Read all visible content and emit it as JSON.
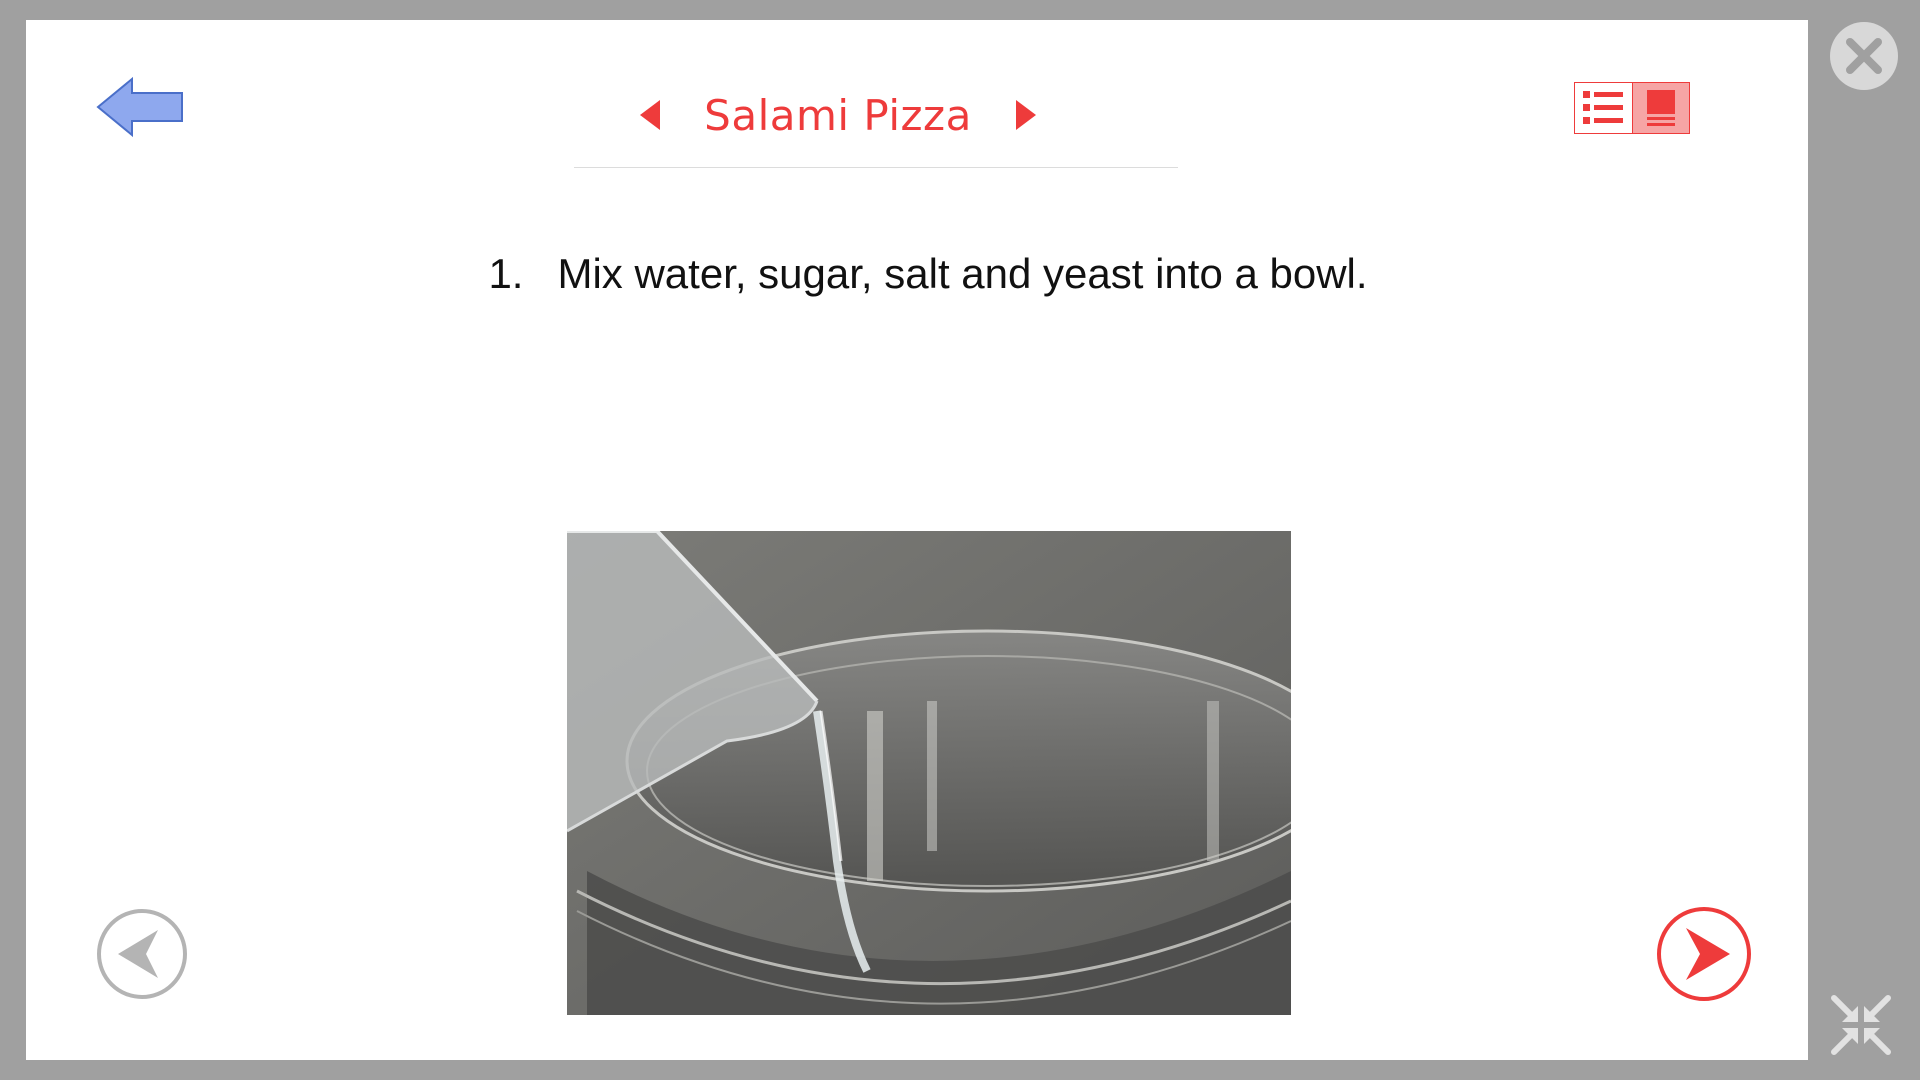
{
  "header": {
    "back_icon": "back-arrow-icon",
    "title": "Salami Pizza",
    "prev_recipe_icon": "triangle-left-icon",
    "next_recipe_icon": "triangle-right-icon"
  },
  "view_toggle": {
    "list_icon": "list-view-icon",
    "single_icon": "single-view-icon",
    "active": "single"
  },
  "step": {
    "number": "1.",
    "text": "Mix water, sugar, salt and yeast into a bowl."
  },
  "photo": {
    "icon": "water-pouring-into-bowl-photo"
  },
  "controls": {
    "prev_step_icon": "circle-prev-arrow-icon",
    "next_step_icon": "circle-next-arrow-icon",
    "close_icon": "close-icon",
    "shrink_icon": "exit-fullscreen-icon"
  },
  "colors": {
    "accent": "#ee3b3b",
    "accent_light": "#f6a5a5",
    "back_arrow": "#8ea8ee",
    "frame": "#a0a0a0",
    "disabled": "#b4b4b4"
  }
}
